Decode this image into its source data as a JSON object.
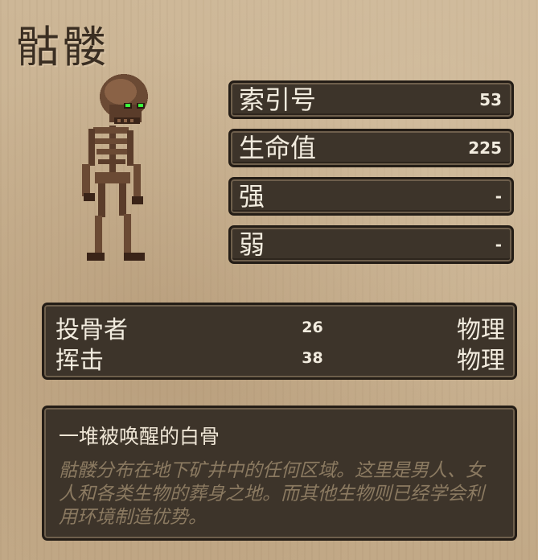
{
  "creature": {
    "name": "骷髅",
    "image_icon": "skeleton-sprite"
  },
  "stats": [
    {
      "label": "索引号",
      "value": "53"
    },
    {
      "label": "生命值",
      "value": "225"
    },
    {
      "label": "强",
      "value": "-"
    },
    {
      "label": "弱",
      "value": "-"
    }
  ],
  "attacks": [
    {
      "name": "投骨者",
      "damage": "26",
      "type": "物理"
    },
    {
      "name": "挥击",
      "damage": "38",
      "type": "物理"
    }
  ],
  "description": {
    "heading": "一堆被唤醒的白骨",
    "body": "骷髅分布在地下矿井中的任何区域。这里是男人、女人和各类生物的葬身之地。而其他生物则已经学会利用环境制造优势。"
  },
  "colors": {
    "background": "#c7b092",
    "panel": "#3d342a",
    "eye_glow": "#3cff3c"
  }
}
